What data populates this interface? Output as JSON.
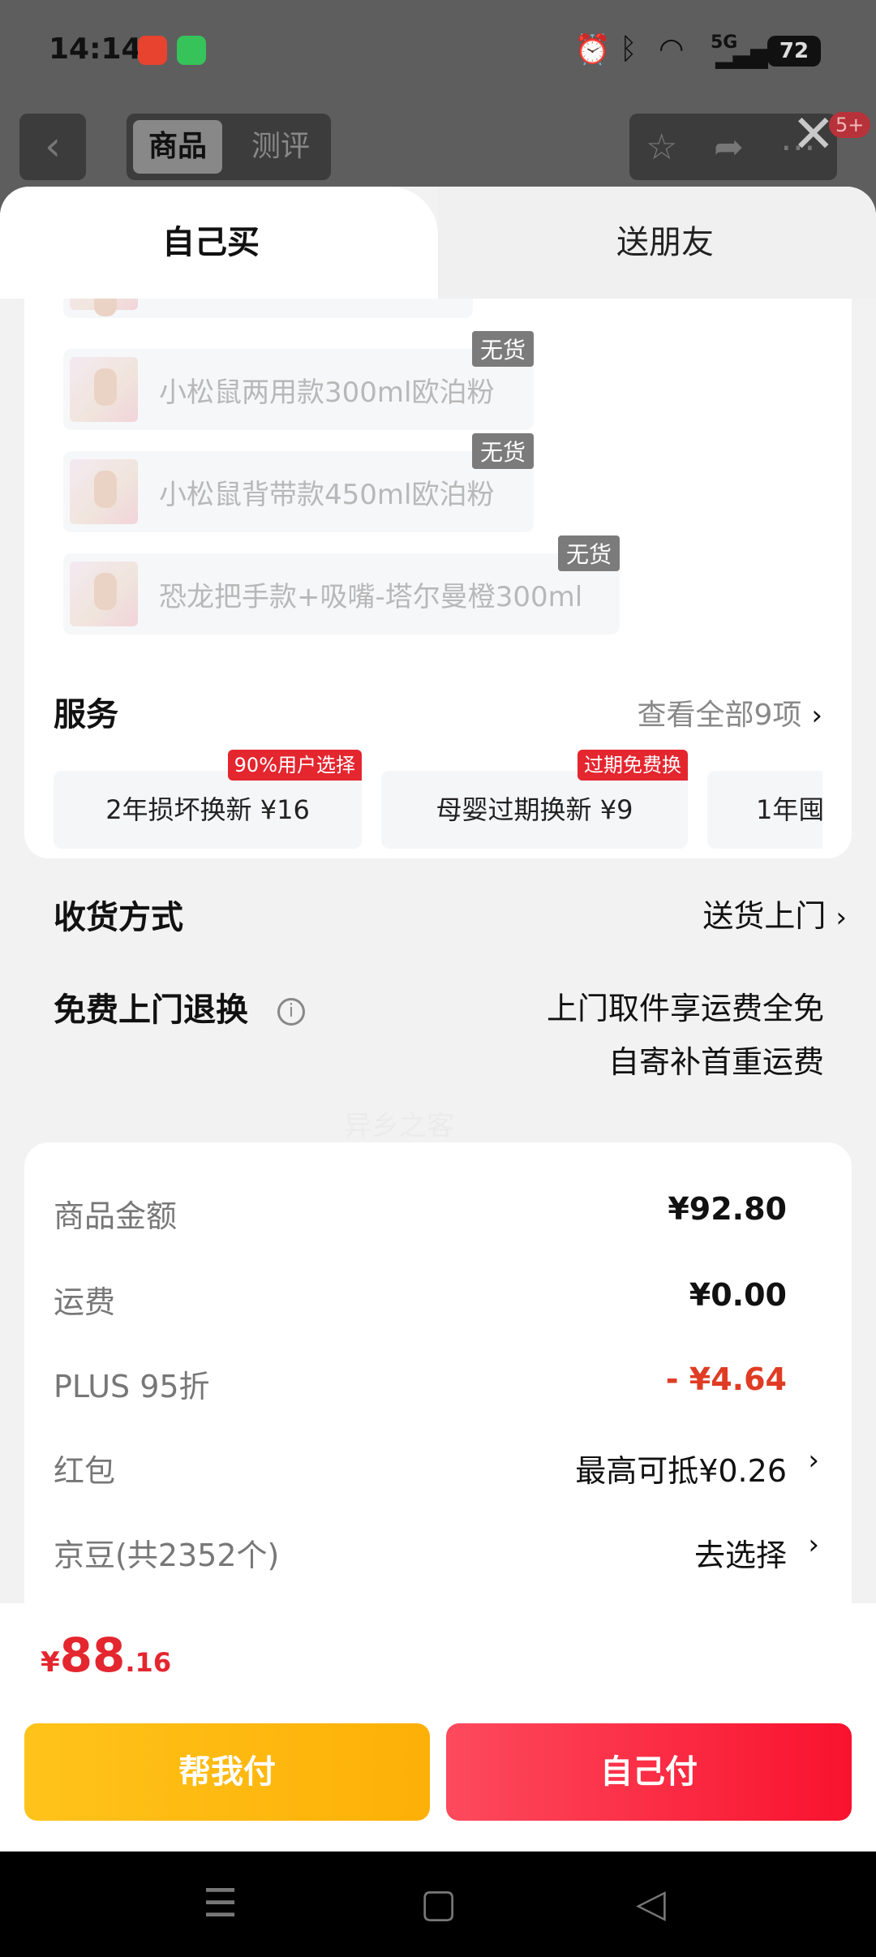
{
  "status_bar": {
    "time": "14:14",
    "battery": "72",
    "network": "5G"
  },
  "background_nav": {
    "tab_active": "商品",
    "tab_other": "测评",
    "badge": "5+"
  },
  "tabs": {
    "self_buy": "自己买",
    "send_friend": "送朋友"
  },
  "skus": [
    {
      "label": "小松鼠两用款300ml欧泊粉",
      "tag": "无货"
    },
    {
      "label": "小松鼠背带款450ml欧泊粉",
      "tag": "无货"
    },
    {
      "label": "恐龙把手款+吸嘴-塔尔曼橙300ml",
      "tag": "无货"
    }
  ],
  "services": {
    "title": "服务",
    "view_all": "查看全部9项",
    "items": [
      {
        "label": "2年损坏换新 ¥16",
        "tag": "90%用户选择"
      },
      {
        "label": "母婴过期换新 ¥9",
        "tag": "过期免费换"
      },
      {
        "label": "1年囤",
        "tag": ""
      }
    ]
  },
  "delivery": {
    "title": "收货方式",
    "value": "送货上门"
  },
  "free_return": {
    "title": "免费上门退换",
    "line1": "上门取件享运费全免",
    "line2": "自寄补首重运费"
  },
  "watermark": "异乡之客",
  "summary": {
    "rows": [
      {
        "label": "商品金额",
        "value": "¥92.80"
      },
      {
        "label": "运费",
        "value": "¥0.00"
      },
      {
        "label": "PLUS 95折",
        "value": "- ¥4.64"
      },
      {
        "label": "红包",
        "value": "最高可抵¥0.26"
      },
      {
        "label": "京豆(共2352个)",
        "value": "去选择"
      }
    ]
  },
  "total": {
    "symbol": "¥",
    "integer": "88",
    "decimal": ".16"
  },
  "buttons": {
    "help_pay": "帮我付",
    "self_pay": "自己付"
  },
  "colors": {
    "accent_red": "#e4262f",
    "pay_yellow": "#fdb007",
    "pay_red": "#f9122e"
  }
}
